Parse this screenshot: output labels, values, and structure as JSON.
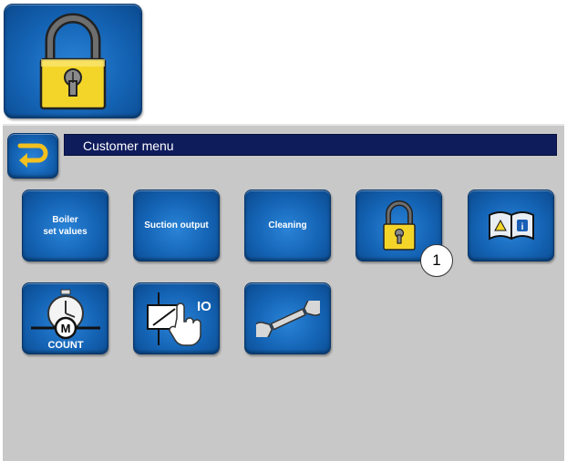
{
  "header_icon": {
    "icon": "padlock-icon"
  },
  "title_bar": {
    "title": "Customer menu",
    "back_icon": "return-arrow-icon"
  },
  "menu": {
    "boiler_set_values": "Boiler\nset values",
    "suction_output": "Suction output",
    "cleaning": "Cleaning",
    "lock_icon": "padlock-icon",
    "manual_icon": "warning-manual-icon",
    "motor_count": {
      "motor": "M",
      "label": "COUNT"
    },
    "relay_test": {
      "label": "IO"
    },
    "service_icon": "wrench-icon"
  },
  "callout": {
    "number": "1"
  },
  "colors": {
    "tile": "#1463b4",
    "title_bar": "#0f1c5c",
    "panel": "#c8c8c8",
    "lock_yellow": "#f3d52a"
  }
}
